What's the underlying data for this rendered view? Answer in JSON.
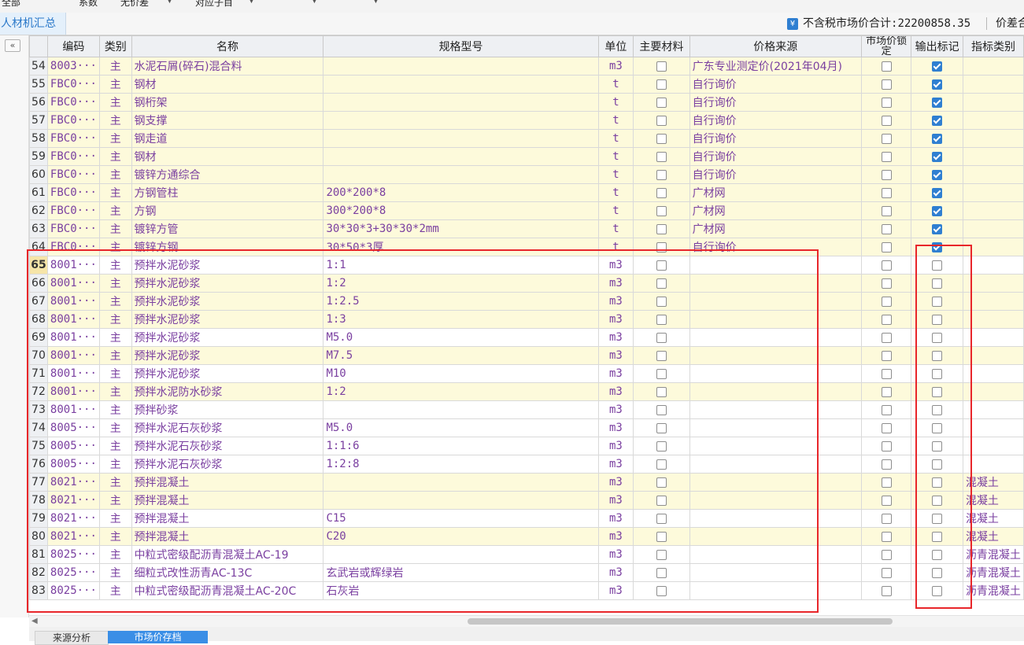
{
  "top_menu": {
    "items": [
      {
        "label": "全部"
      },
      {
        "label": "系数"
      },
      {
        "label": "无价差"
      },
      {
        "label": "对应子目"
      }
    ]
  },
  "tabs": {
    "active_label": "人材机汇总"
  },
  "summary": {
    "currency_icon": "¥",
    "total_label": "不含税市场价合计:",
    "total_value": "22200858.35",
    "diff_label": "价差合"
  },
  "grid": {
    "collapse_icon": "«",
    "columns": {
      "code": "编码",
      "category": "类别",
      "name": "名称",
      "spec": "规格型号",
      "unit": "单位",
      "main_material": "主要材料",
      "price_source": "价格来源",
      "market_lock": "市场价锁定",
      "output_flag": "输出标记",
      "indicator_type": "指标类别"
    },
    "rows": [
      {
        "num": "54",
        "code": "8003···",
        "cat": "主",
        "name": "水泥石屑(碎石)混合料",
        "spec": "",
        "unit": "m3",
        "main": false,
        "source": "广东专业测定价(2021年04月)",
        "lock": false,
        "output": true,
        "indicator": "",
        "bg": "y"
      },
      {
        "num": "55",
        "code": "FBC0···",
        "cat": "主",
        "name": "钢材",
        "spec": "",
        "unit": "t",
        "main": false,
        "source": "自行询价",
        "lock": false,
        "output": true,
        "indicator": "",
        "bg": "y"
      },
      {
        "num": "56",
        "code": "FBC0···",
        "cat": "主",
        "name": "钢桁架",
        "spec": "",
        "unit": "t",
        "main": false,
        "source": "自行询价",
        "lock": false,
        "output": true,
        "indicator": "",
        "bg": "y"
      },
      {
        "num": "57",
        "code": "FBC0···",
        "cat": "主",
        "name": "钢支撑",
        "spec": "",
        "unit": "t",
        "main": false,
        "source": "自行询价",
        "lock": false,
        "output": true,
        "indicator": "",
        "bg": "y"
      },
      {
        "num": "58",
        "code": "FBC0···",
        "cat": "主",
        "name": "钢走道",
        "spec": "",
        "unit": "t",
        "main": false,
        "source": "自行询价",
        "lock": false,
        "output": true,
        "indicator": "",
        "bg": "y"
      },
      {
        "num": "59",
        "code": "FBC0···",
        "cat": "主",
        "name": "钢材",
        "spec": "",
        "unit": "t",
        "main": false,
        "source": "自行询价",
        "lock": false,
        "output": true,
        "indicator": "",
        "bg": "y"
      },
      {
        "num": "60",
        "code": "FBC0···",
        "cat": "主",
        "name": "镀锌方通综合",
        "spec": "",
        "unit": "t",
        "main": false,
        "source": "自行询价",
        "lock": false,
        "output": true,
        "indicator": "",
        "bg": "y"
      },
      {
        "num": "61",
        "code": "FBC0···",
        "cat": "主",
        "name": "方钢管柱",
        "spec": "200*200*8",
        "unit": "t",
        "main": false,
        "source": "广材网",
        "lock": false,
        "output": true,
        "indicator": "",
        "bg": "y"
      },
      {
        "num": "62",
        "code": "FBC0···",
        "cat": "主",
        "name": "方钢",
        "spec": "300*200*8",
        "unit": "t",
        "main": false,
        "source": "广材网",
        "lock": false,
        "output": true,
        "indicator": "",
        "bg": "y"
      },
      {
        "num": "63",
        "code": "FBC0···",
        "cat": "主",
        "name": "镀锌方管",
        "spec": "30*30*3+30*30*2mm",
        "unit": "t",
        "main": false,
        "source": "广材网",
        "lock": false,
        "output": true,
        "indicator": "",
        "bg": "y"
      },
      {
        "num": "64",
        "code": "FBC0···",
        "cat": "主",
        "name": "镀锌方钢",
        "spec": "30*50*3厚",
        "unit": "t",
        "main": false,
        "source": "自行询价",
        "lock": false,
        "output": true,
        "indicator": "",
        "bg": "y"
      },
      {
        "num": "65",
        "code": "8001···",
        "cat": "主",
        "name": "预拌水泥砂浆",
        "spec": "1:1",
        "unit": "m3",
        "main": false,
        "source": "",
        "lock": false,
        "output": false,
        "indicator": "",
        "bg": "w",
        "sel": true
      },
      {
        "num": "66",
        "code": "8001···",
        "cat": "主",
        "name": "预拌水泥砂浆",
        "spec": "1:2",
        "unit": "m3",
        "main": false,
        "source": "",
        "lock": false,
        "output": false,
        "indicator": "",
        "bg": "y"
      },
      {
        "num": "67",
        "code": "8001···",
        "cat": "主",
        "name": "预拌水泥砂浆",
        "spec": "1:2.5",
        "unit": "m3",
        "main": false,
        "source": "",
        "lock": false,
        "output": false,
        "indicator": "",
        "bg": "y"
      },
      {
        "num": "68",
        "code": "8001···",
        "cat": "主",
        "name": "预拌水泥砂浆",
        "spec": "1:3",
        "unit": "m3",
        "main": false,
        "source": "",
        "lock": false,
        "output": false,
        "indicator": "",
        "bg": "y"
      },
      {
        "num": "69",
        "code": "8001···",
        "cat": "主",
        "name": "预拌水泥砂浆",
        "spec": "M5.0",
        "unit": "m3",
        "main": false,
        "source": "",
        "lock": false,
        "output": false,
        "indicator": "",
        "bg": "w"
      },
      {
        "num": "70",
        "code": "8001···",
        "cat": "主",
        "name": "预拌水泥砂浆",
        "spec": "M7.5",
        "unit": "m3",
        "main": false,
        "source": "",
        "lock": false,
        "output": false,
        "indicator": "",
        "bg": "y"
      },
      {
        "num": "71",
        "code": "8001···",
        "cat": "主",
        "name": "预拌水泥砂浆",
        "spec": "M10",
        "unit": "m3",
        "main": false,
        "source": "",
        "lock": false,
        "output": false,
        "indicator": "",
        "bg": "w"
      },
      {
        "num": "72",
        "code": "8001···",
        "cat": "主",
        "name": "预拌水泥防水砂浆",
        "spec": "1:2",
        "unit": "m3",
        "main": false,
        "source": "",
        "lock": false,
        "output": false,
        "indicator": "",
        "bg": "y"
      },
      {
        "num": "73",
        "code": "8001···",
        "cat": "主",
        "name": "预拌砂浆",
        "spec": "",
        "unit": "m3",
        "main": false,
        "source": "",
        "lock": false,
        "output": false,
        "indicator": "",
        "bg": "w"
      },
      {
        "num": "74",
        "code": "8005···",
        "cat": "主",
        "name": "预拌水泥石灰砂浆",
        "spec": "M5.0",
        "unit": "m3",
        "main": false,
        "source": "",
        "lock": false,
        "output": false,
        "indicator": "",
        "bg": "w"
      },
      {
        "num": "75",
        "code": "8005···",
        "cat": "主",
        "name": "预拌水泥石灰砂浆",
        "spec": "1:1:6",
        "unit": "m3",
        "main": false,
        "source": "",
        "lock": false,
        "output": false,
        "indicator": "",
        "bg": "w"
      },
      {
        "num": "76",
        "code": "8005···",
        "cat": "主",
        "name": "预拌水泥石灰砂浆",
        "spec": "1:2:8",
        "unit": "m3",
        "main": false,
        "source": "",
        "lock": false,
        "output": false,
        "indicator": "",
        "bg": "w"
      },
      {
        "num": "77",
        "code": "8021···",
        "cat": "主",
        "name": "预拌混凝土",
        "spec": "",
        "unit": "m3",
        "main": false,
        "source": "",
        "lock": false,
        "output": false,
        "indicator": "混凝土",
        "bg": "y"
      },
      {
        "num": "78",
        "code": "8021···",
        "cat": "主",
        "name": "预拌混凝土",
        "spec": "",
        "unit": "m3",
        "main": false,
        "source": "",
        "lock": false,
        "output": false,
        "indicator": "混凝土",
        "bg": "y"
      },
      {
        "num": "79",
        "code": "8021···",
        "cat": "主",
        "name": "预拌混凝土",
        "spec": "C15",
        "unit": "m3",
        "main": false,
        "source": "",
        "lock": false,
        "output": false,
        "indicator": "混凝土",
        "bg": "w"
      },
      {
        "num": "80",
        "code": "8021···",
        "cat": "主",
        "name": "预拌混凝土",
        "spec": "C20",
        "unit": "m3",
        "main": false,
        "source": "",
        "lock": false,
        "output": false,
        "indicator": "混凝土",
        "bg": "y"
      },
      {
        "num": "81",
        "code": "8025···",
        "cat": "主",
        "name": "中粒式密级配沥青混凝土AC-19",
        "spec": "",
        "unit": "m3",
        "main": false,
        "source": "",
        "lock": false,
        "output": false,
        "indicator": "沥青混凝土",
        "bg": "w"
      },
      {
        "num": "82",
        "code": "8025···",
        "cat": "主",
        "name": "细粒式改性沥青AC-13C",
        "spec": "玄武岩或辉绿岩",
        "unit": "m3",
        "main": false,
        "source": "",
        "lock": false,
        "output": false,
        "indicator": "沥青混凝土",
        "bg": "w"
      },
      {
        "num": "83",
        "code": "8025···",
        "cat": "主",
        "name": "中粒式密级配沥青混凝土AC-20C",
        "spec": "石灰岩",
        "unit": "m3",
        "main": false,
        "source": "",
        "lock": false,
        "output": false,
        "indicator": "沥青混凝土",
        "bg": "w"
      }
    ]
  },
  "bottom_tabs": [
    {
      "label": "来源分析"
    },
    {
      "label": "市场价存档"
    }
  ],
  "colors": {
    "accent": "#2f7fd1",
    "row_yellow": "#fdfadb",
    "text_purple": "#7a3fa0",
    "highlight_red": "#e8262a"
  }
}
